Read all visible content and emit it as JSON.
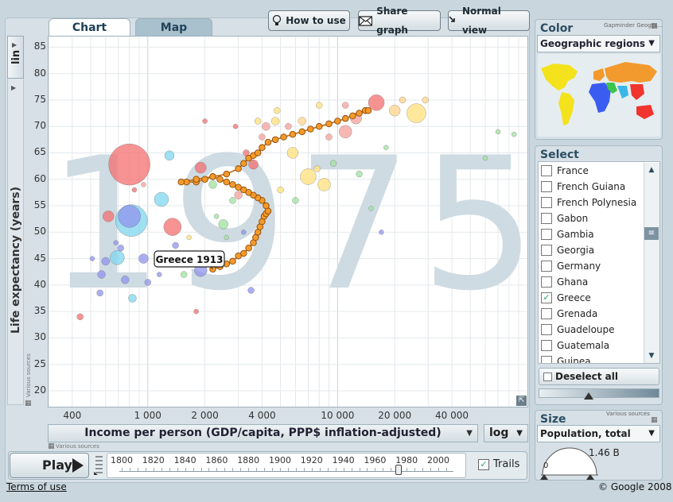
{
  "tabs": {
    "chart": "Chart",
    "map": "Map"
  },
  "toolbar": {
    "how": "How to use",
    "share": "Share graph",
    "normal": "Normal view"
  },
  "yaxis": {
    "scale_label": "lin",
    "title": "Life expectancy (years)",
    "sources": "Various sources",
    "ticks": [
      "20",
      "25",
      "30",
      "35",
      "40",
      "45",
      "50",
      "55",
      "60",
      "65",
      "70",
      "75",
      "80",
      "85"
    ]
  },
  "xaxis": {
    "title": "Income per person (GDP/capita, PPP$ inflation-adjusted)",
    "scale": "log",
    "sources": "Various sources",
    "ticks": [
      "400",
      "1 000",
      "2 000",
      "4 000",
      "10 000",
      "20 000",
      "40 000"
    ]
  },
  "chart": {
    "year_watermark": "1975",
    "tooltip": "Greece 1913"
  },
  "play": {
    "label": "Play",
    "trails": "Trails",
    "years": [
      "1800",
      "1820",
      "1840",
      "1860",
      "1880",
      "1900",
      "1920",
      "1940",
      "1960",
      "1980",
      "2000"
    ]
  },
  "color_panel": {
    "title": "Color",
    "source": "Gapminder Geogra...",
    "selected": "Geographic regions"
  },
  "select_panel": {
    "title": "Select",
    "deselect": "Deselect all",
    "items": [
      {
        "label": "France",
        "checked": false
      },
      {
        "label": "French Guiana",
        "checked": false
      },
      {
        "label": "French Polynesia",
        "checked": false
      },
      {
        "label": "Gabon",
        "checked": false
      },
      {
        "label": "Gambia",
        "checked": false
      },
      {
        "label": "Georgia",
        "checked": false
      },
      {
        "label": "Germany",
        "checked": false
      },
      {
        "label": "Ghana",
        "checked": false
      },
      {
        "label": "Greece",
        "checked": true
      },
      {
        "label": "Grenada",
        "checked": false
      },
      {
        "label": "Guadeloupe",
        "checked": false
      },
      {
        "label": "Guatemala",
        "checked": false
      },
      {
        "label": "Guinea",
        "checked": false
      }
    ]
  },
  "size_panel": {
    "title": "Size",
    "source": "Various sources",
    "selected": "Population, total",
    "min": "0",
    "max": "1.46 B"
  },
  "footer": {
    "terms": "Terms of use",
    "copyright": "© Google 2008"
  },
  "chart_data": {
    "type": "scatter",
    "xscale": "log",
    "xlim": [
      300,
      100000
    ],
    "ylim": [
      17,
      87
    ],
    "xlabel": "Income per person (GDP/capita, PPP$ inflation-adjusted)",
    "ylabel": "Life expectancy (years)",
    "trail": {
      "name": "Greece",
      "x": [
        2200,
        2400,
        2600,
        2800,
        3000,
        3200,
        3400,
        3600,
        3700,
        3800,
        3900,
        4000,
        4100,
        4200,
        4300,
        4200,
        4000,
        3800,
        3600,
        3400,
        3200,
        3000,
        2800,
        2600,
        2400,
        2200,
        2000,
        1800,
        1600,
        1500,
        1800,
        2200,
        2600,
        3000,
        3200,
        3400,
        3600,
        3800,
        4000,
        4300,
        4700,
        5200,
        5800,
        6500,
        7200,
        8000,
        9000,
        10000,
        11000,
        12000,
        13000,
        14000,
        14500
      ],
      "y": [
        43,
        43.5,
        44,
        44.5,
        45.5,
        46,
        47,
        48,
        49,
        50,
        51,
        52,
        53,
        53.5,
        54,
        55,
        56,
        56.5,
        57,
        57.5,
        58,
        58.5,
        59,
        59.5,
        60,
        60.5,
        60,
        59.5,
        59.5,
        59.5,
        60,
        60.5,
        61,
        62,
        63,
        64,
        64.5,
        65,
        66,
        67,
        67.5,
        68,
        68.5,
        69,
        69.5,
        70,
        70.5,
        71,
        71.5,
        72,
        72.5,
        73,
        73
      ]
    },
    "bubbles": [
      {
        "x": 800,
        "y": 62.8,
        "r": 26,
        "c": "#f46f6f"
      },
      {
        "x": 820,
        "y": 52.2,
        "r": 20,
        "c": "#7fd6ee"
      },
      {
        "x": 800,
        "y": 53,
        "r": 14,
        "c": "#8f93ec"
      },
      {
        "x": 1350,
        "y": 51,
        "r": 11,
        "c": "#f46f6f"
      },
      {
        "x": 1180,
        "y": 56.2,
        "r": 9,
        "c": "#7fd6ee"
      },
      {
        "x": 690,
        "y": 45.2,
        "r": 9,
        "c": "#7fd6ee"
      },
      {
        "x": 1900,
        "y": 42.8,
        "r": 8,
        "c": "#8f93ec"
      },
      {
        "x": 620,
        "y": 53,
        "r": 7,
        "c": "#f46f6f"
      },
      {
        "x": 1900,
        "y": 62.2,
        "r": 7,
        "c": "#f46f6f"
      },
      {
        "x": 26000,
        "y": 72.5,
        "r": 12,
        "c": "#ffe07a"
      },
      {
        "x": 16000,
        "y": 74.5,
        "r": 10,
        "c": "#f46f6f"
      },
      {
        "x": 7000,
        "y": 60.5,
        "r": 10,
        "c": "#ffe07a"
      },
      {
        "x": 11000,
        "y": 69,
        "r": 8,
        "c": "#f4a09a"
      },
      {
        "x": 8500,
        "y": 59,
        "r": 8,
        "c": "#ffe07a"
      },
      {
        "x": 950,
        "y": 45,
        "r": 6,
        "c": "#8f93ec"
      },
      {
        "x": 1300,
        "y": 64.5,
        "r": 6,
        "c": "#7fd6ee"
      },
      {
        "x": 2500,
        "y": 51.5,
        "r": 6,
        "c": "#9fe29f"
      },
      {
        "x": 3600,
        "y": 62.8,
        "r": 6,
        "c": "#f46f6f"
      },
      {
        "x": 5800,
        "y": 65,
        "r": 7,
        "c": "#ffe07a"
      },
      {
        "x": 12500,
        "y": 71.5,
        "r": 7,
        "c": "#f4a09a"
      },
      {
        "x": 20000,
        "y": 73,
        "r": 7,
        "c": "#ffd48a"
      },
      {
        "x": 4200,
        "y": 70,
        "r": 5,
        "c": "#f4a09a"
      },
      {
        "x": 3000,
        "y": 57,
        "r": 5,
        "c": "#f4a09a"
      },
      {
        "x": 4700,
        "y": 71,
        "r": 5,
        "c": "#ffe07a"
      },
      {
        "x": 6500,
        "y": 71,
        "r": 5,
        "c": "#ffd48a"
      },
      {
        "x": 2200,
        "y": 59,
        "r": 5,
        "c": "#9fe29f"
      },
      {
        "x": 760,
        "y": 41,
        "r": 5,
        "c": "#8f93ec"
      },
      {
        "x": 600,
        "y": 44.5,
        "r": 5,
        "c": "#8f93ec"
      },
      {
        "x": 570,
        "y": 42,
        "r": 5,
        "c": "#8f93ec"
      },
      {
        "x": 830,
        "y": 37.5,
        "r": 5,
        "c": "#7fd6ee"
      },
      {
        "x": 440,
        "y": 34,
        "r": 4,
        "c": "#f46f6f"
      },
      {
        "x": 560,
        "y": 38.5,
        "r": 4,
        "c": "#8f93ec"
      },
      {
        "x": 720,
        "y": 47,
        "r": 4,
        "c": "#8f93ec"
      },
      {
        "x": 1400,
        "y": 47.5,
        "r": 4,
        "c": "#8f93ec"
      },
      {
        "x": 1000,
        "y": 40.5,
        "r": 4,
        "c": "#8f93ec"
      },
      {
        "x": 1550,
        "y": 42,
        "r": 4,
        "c": "#9fe29f"
      },
      {
        "x": 2800,
        "y": 56,
        "r": 4,
        "c": "#9fe29f"
      },
      {
        "x": 3500,
        "y": 39,
        "r": 4,
        "c": "#8f93ec"
      },
      {
        "x": 3300,
        "y": 65,
        "r": 4,
        "c": "#f46f6f"
      },
      {
        "x": 4000,
        "y": 68,
        "r": 4,
        "c": "#f4a09a"
      },
      {
        "x": 5000,
        "y": 58,
        "r": 4,
        "c": "#ffe07a"
      },
      {
        "x": 6000,
        "y": 56,
        "r": 4,
        "c": "#9fe29f"
      },
      {
        "x": 7800,
        "y": 62,
        "r": 4,
        "c": "#ffe07a"
      },
      {
        "x": 9500,
        "y": 63,
        "r": 4,
        "c": "#9fe29f"
      },
      {
        "x": 13000,
        "y": 61,
        "r": 4,
        "c": "#9fe29f"
      },
      {
        "x": 9000,
        "y": 68,
        "r": 4,
        "c": "#f4a09a"
      },
      {
        "x": 18000,
        "y": 66,
        "r": 3,
        "c": "#9fe29f"
      },
      {
        "x": 15000,
        "y": 54.5,
        "r": 3,
        "c": "#9fe29f"
      },
      {
        "x": 17000,
        "y": 50,
        "r": 3,
        "c": "#8f93ec"
      },
      {
        "x": 4800,
        "y": 73,
        "r": 4,
        "c": "#ffe07a"
      },
      {
        "x": 5500,
        "y": 70,
        "r": 4,
        "c": "#f4a09a"
      },
      {
        "x": 3800,
        "y": 71,
        "r": 4,
        "c": "#ffe07a"
      },
      {
        "x": 2900,
        "y": 70,
        "r": 3,
        "c": "#f46f6f"
      },
      {
        "x": 2600,
        "y": 49,
        "r": 3,
        "c": "#9fe29f"
      },
      {
        "x": 2300,
        "y": 53,
        "r": 3,
        "c": "#9fe29f"
      },
      {
        "x": 1650,
        "y": 49,
        "r": 3,
        "c": "#ffe07a"
      },
      {
        "x": 1250,
        "y": 45,
        "r": 3,
        "c": "#8f93ec"
      },
      {
        "x": 1150,
        "y": 42,
        "r": 3,
        "c": "#8f93ec"
      },
      {
        "x": 680,
        "y": 48,
        "r": 3,
        "c": "#8f93ec"
      },
      {
        "x": 510,
        "y": 45,
        "r": 3,
        "c": "#8f93ec"
      },
      {
        "x": 1800,
        "y": 35,
        "r": 3,
        "c": "#f46f6f"
      },
      {
        "x": 3200,
        "y": 50,
        "r": 3,
        "c": "#8f93ec"
      },
      {
        "x": 22000,
        "y": 75,
        "r": 4,
        "c": "#ffd48a"
      },
      {
        "x": 29000,
        "y": 75,
        "r": 4,
        "c": "#ffd48a"
      },
      {
        "x": 8000,
        "y": 74,
        "r": 4,
        "c": "#ffe07a"
      },
      {
        "x": 11000,
        "y": 74,
        "r": 4,
        "c": "#f4a09a"
      },
      {
        "x": 14000,
        "y": 73,
        "r": 4,
        "c": "#f4a09a"
      },
      {
        "x": 60000,
        "y": 64,
        "r": 3,
        "c": "#9fe29f"
      },
      {
        "x": 70000,
        "y": 69,
        "r": 3,
        "c": "#9fe29f"
      },
      {
        "x": 85000,
        "y": 68.5,
        "r": 3,
        "c": "#9fe29f"
      },
      {
        "x": 2000,
        "y": 71,
        "r": 3,
        "c": "#f46f6f"
      },
      {
        "x": 850,
        "y": 58,
        "r": 3,
        "c": "#f46f6f"
      },
      {
        "x": 950,
        "y": 59,
        "r": 3,
        "c": "#f4a09a"
      }
    ]
  }
}
